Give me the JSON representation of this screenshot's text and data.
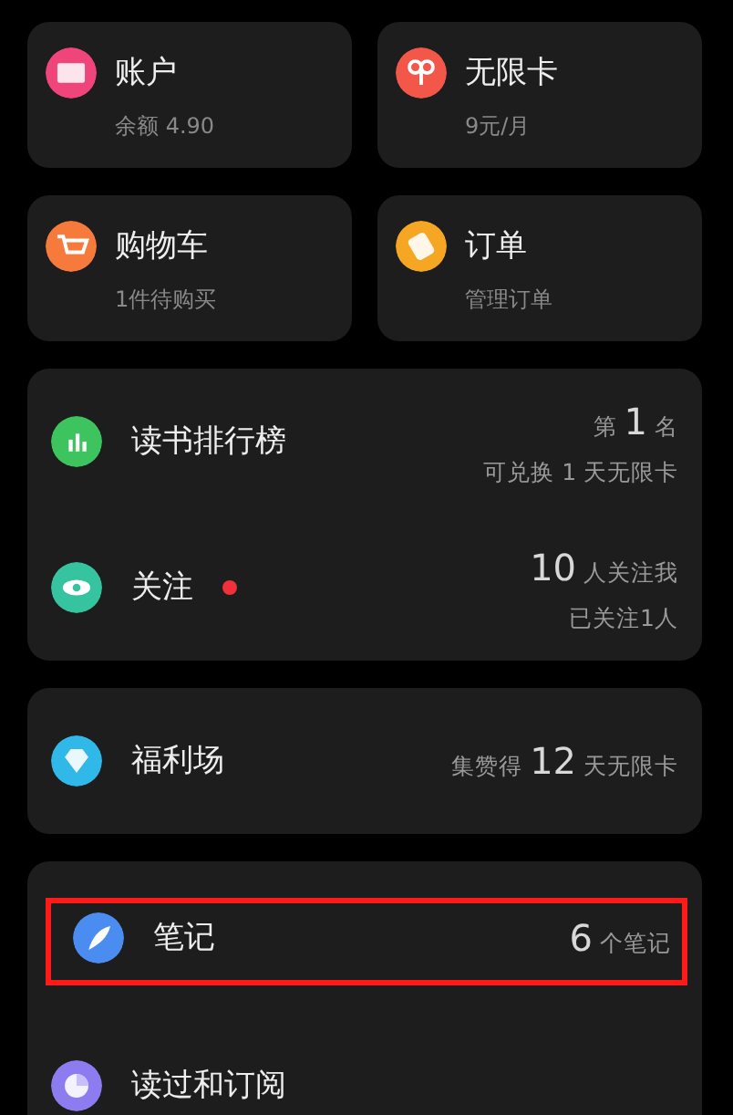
{
  "tiles": [
    {
      "title": "账户",
      "subtitle": "余额 4.90",
      "kind": "wallet",
      "color": "#f0457a"
    },
    {
      "title": "无限卡",
      "subtitle": "9元/月",
      "kind": "knot",
      "color": "#f2574a"
    },
    {
      "title": "购物车",
      "subtitle": "1件待购买",
      "kind": "cart",
      "color": "#f57a3c"
    },
    {
      "title": "订单",
      "subtitle": "管理订单",
      "kind": "ticket",
      "color": "#f5a623"
    }
  ],
  "groups": [
    {
      "rows": [
        {
          "title": "读书排行榜",
          "kind": "chart",
          "color": "#3dc45e",
          "dot": false,
          "highlighted": false,
          "lines": [
            [
              {
                "text": "第",
                "big": false
              },
              {
                "text": "1",
                "big": true
              },
              {
                "text": "名",
                "big": false
              }
            ],
            [
              {
                "text": "可兑换 1 天无限卡",
                "big": false
              }
            ]
          ]
        },
        {
          "title": "关注",
          "kind": "eye",
          "color": "#36c3a0",
          "dot": true,
          "highlighted": false,
          "lines": [
            [
              {
                "text": "10",
                "big": true
              },
              {
                "text": "人关注我",
                "big": false
              }
            ],
            [
              {
                "text": "已关注1人",
                "big": false
              }
            ]
          ]
        }
      ]
    },
    {
      "rows": [
        {
          "title": "福利场",
          "kind": "diamond",
          "color": "#2fb8e8",
          "dot": false,
          "highlighted": false,
          "lines": [
            [
              {
                "text": "集赞得",
                "big": false
              },
              {
                "text": "12",
                "big": true
              },
              {
                "text": "天无限卡",
                "big": false
              }
            ]
          ]
        }
      ]
    },
    {
      "rows": [
        {
          "title": "笔记",
          "kind": "feather",
          "color": "#4a8cf0",
          "dot": false,
          "highlighted": true,
          "lines": [
            [
              {
                "text": "6",
                "big": true
              },
              {
                "text": "个笔记",
                "big": false
              }
            ]
          ]
        },
        {
          "title": "读过和订阅",
          "kind": "pie",
          "color": "#8c7cf0",
          "dot": false,
          "highlighted": false,
          "lines": []
        }
      ]
    }
  ]
}
